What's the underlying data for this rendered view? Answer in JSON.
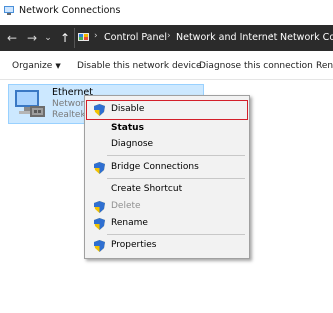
{
  "window": {
    "title": "Network Connections"
  },
  "breadcrumb": [
    "Control Panel",
    "Network and Internet",
    "Network Conn"
  ],
  "commands": {
    "organize": "Organize",
    "disable": "Disable this network device",
    "diagnose": "Diagnose this connection",
    "more": "Rena"
  },
  "adapter": {
    "name": "Ethernet",
    "line1": "Networ",
    "line2": "Realtek"
  },
  "context_menu": {
    "disable": "Disable",
    "status": "Status",
    "diagnose": "Diagnose",
    "bridge": "Bridge Connections",
    "shortcut": "Create Shortcut",
    "delete": "Delete",
    "rename": "Rename",
    "properties": "Properties"
  },
  "colors": {
    "selection": "#cce8ff",
    "highlight_border": "#d31f2a",
    "nav_bg": "#2b2b2b"
  }
}
